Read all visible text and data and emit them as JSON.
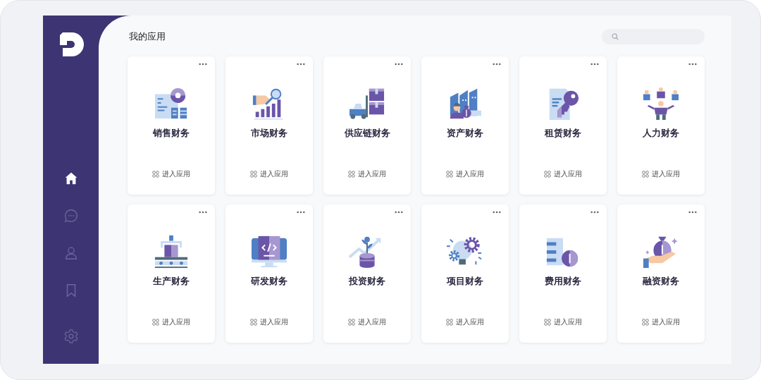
{
  "sidebar": {
    "items": [
      {
        "kind": "home",
        "selected": true
      },
      {
        "kind": "chat",
        "selected": false
      },
      {
        "kind": "user",
        "selected": false
      },
      {
        "kind": "bookmark",
        "selected": false
      }
    ],
    "footer_item": {
      "kind": "settings",
      "selected": false
    }
  },
  "header": {
    "title": "我的应用"
  },
  "apps": [
    {
      "name": "销售财务",
      "kind": "sales",
      "action": "进入应用"
    },
    {
      "name": "市场财务",
      "kind": "market",
      "action": "进入应用"
    },
    {
      "name": "供应链财务",
      "kind": "supply",
      "action": "进入应用"
    },
    {
      "name": "资产财务",
      "kind": "asset",
      "action": "进入应用"
    },
    {
      "name": "租赁财务",
      "kind": "lease",
      "action": "进入应用"
    },
    {
      "name": "人力财务",
      "kind": "hr",
      "action": "进入应用"
    },
    {
      "name": "生产财务",
      "kind": "production",
      "action": "进入应用"
    },
    {
      "name": "研发财务",
      "kind": "rd",
      "action": "进入应用"
    },
    {
      "name": "投资财务",
      "kind": "invest",
      "action": "进入应用"
    },
    {
      "name": "项目财务",
      "kind": "project",
      "action": "进入应用"
    },
    {
      "name": "费用财务",
      "kind": "expense",
      "action": "进入应用"
    },
    {
      "name": "融资财务",
      "kind": "financing",
      "action": "进入应用"
    }
  ]
}
